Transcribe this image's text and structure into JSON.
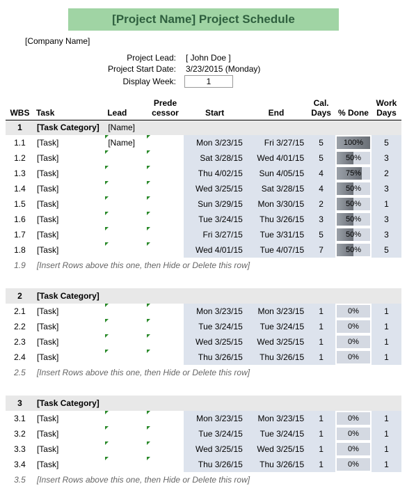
{
  "title": "[Project Name] Project Schedule",
  "company": "[Company Name]",
  "meta": {
    "lead_label": "Project Lead:",
    "lead_value": "[ John Doe ]",
    "start_label": "Project Start Date:",
    "start_value": "3/23/2015 (Monday)",
    "week_label": "Display Week:",
    "week_value": "1"
  },
  "headers": {
    "wbs": "WBS",
    "task": "Task",
    "lead": "Lead",
    "pred": "Prede cessor",
    "start": "Start",
    "end": "End",
    "cal": "Cal. Days",
    "pct": "% Done",
    "work": "Work Days"
  },
  "insert_text": "[Insert Rows above this one, then Hide or Delete this row]",
  "groups": [
    {
      "wbs": "1",
      "category": "[Task Category]",
      "lead": "[Name]",
      "rows": [
        {
          "wbs": "1.1",
          "task": "[Task]",
          "lead": "[Name]",
          "start": "Mon 3/23/15",
          "end": "Fri 3/27/15",
          "cal": "5",
          "pct": 100,
          "pct_txt": "100%",
          "work": "5"
        },
        {
          "wbs": "1.2",
          "task": "[Task]",
          "lead": "",
          "start": "Sat 3/28/15",
          "end": "Wed 4/01/15",
          "cal": "5",
          "pct": 50,
          "pct_txt": "50%",
          "work": "3"
        },
        {
          "wbs": "1.3",
          "task": "[Task]",
          "lead": "",
          "start": "Thu 4/02/15",
          "end": "Sun 4/05/15",
          "cal": "4",
          "pct": 75,
          "pct_txt": "75%",
          "work": "2"
        },
        {
          "wbs": "1.4",
          "task": "[Task]",
          "lead": "",
          "start": "Wed 3/25/15",
          "end": "Sat 3/28/15",
          "cal": "4",
          "pct": 50,
          "pct_txt": "50%",
          "work": "3"
        },
        {
          "wbs": "1.5",
          "task": "[Task]",
          "lead": "",
          "start": "Sun 3/29/15",
          "end": "Mon 3/30/15",
          "cal": "2",
          "pct": 50,
          "pct_txt": "50%",
          "work": "1"
        },
        {
          "wbs": "1.6",
          "task": "[Task]",
          "lead": "",
          "start": "Tue 3/24/15",
          "end": "Thu 3/26/15",
          "cal": "3",
          "pct": 50,
          "pct_txt": "50%",
          "work": "3"
        },
        {
          "wbs": "1.7",
          "task": "[Task]",
          "lead": "",
          "start": "Fri 3/27/15",
          "end": "Tue 3/31/15",
          "cal": "5",
          "pct": 50,
          "pct_txt": "50%",
          "work": "3"
        },
        {
          "wbs": "1.8",
          "task": "[Task]",
          "lead": "",
          "start": "Wed 4/01/15",
          "end": "Tue 4/07/15",
          "cal": "7",
          "pct": 50,
          "pct_txt": "50%",
          "work": "5"
        }
      ],
      "insert_wbs": "1.9"
    },
    {
      "wbs": "2",
      "category": "[Task Category]",
      "lead": "",
      "rows": [
        {
          "wbs": "2.1",
          "task": "[Task]",
          "lead": "",
          "start": "Mon 3/23/15",
          "end": "Mon 3/23/15",
          "cal": "1",
          "pct": 0,
          "pct_txt": "0%",
          "work": "1"
        },
        {
          "wbs": "2.2",
          "task": "[Task]",
          "lead": "",
          "start": "Tue 3/24/15",
          "end": "Tue 3/24/15",
          "cal": "1",
          "pct": 0,
          "pct_txt": "0%",
          "work": "1"
        },
        {
          "wbs": "2.3",
          "task": "[Task]",
          "lead": "",
          "start": "Wed 3/25/15",
          "end": "Wed 3/25/15",
          "cal": "1",
          "pct": 0,
          "pct_txt": "0%",
          "work": "1"
        },
        {
          "wbs": "2.4",
          "task": "[Task]",
          "lead": "",
          "start": "Thu 3/26/15",
          "end": "Thu 3/26/15",
          "cal": "1",
          "pct": 0,
          "pct_txt": "0%",
          "work": "1"
        }
      ],
      "insert_wbs": "2.5"
    },
    {
      "wbs": "3",
      "category": "[Task Category]",
      "lead": "",
      "rows": [
        {
          "wbs": "3.1",
          "task": "[Task]",
          "lead": "",
          "start": "Mon 3/23/15",
          "end": "Mon 3/23/15",
          "cal": "1",
          "pct": 0,
          "pct_txt": "0%",
          "work": "1"
        },
        {
          "wbs": "3.2",
          "task": "[Task]",
          "lead": "",
          "start": "Tue 3/24/15",
          "end": "Tue 3/24/15",
          "cal": "1",
          "pct": 0,
          "pct_txt": "0%",
          "work": "1"
        },
        {
          "wbs": "3.3",
          "task": "[Task]",
          "lead": "",
          "start": "Wed 3/25/15",
          "end": "Wed 3/25/15",
          "cal": "1",
          "pct": 0,
          "pct_txt": "0%",
          "work": "1"
        },
        {
          "wbs": "3.4",
          "task": "[Task]",
          "lead": "",
          "start": "Thu 3/26/15",
          "end": "Thu 3/26/15",
          "cal": "1",
          "pct": 0,
          "pct_txt": "0%",
          "work": "1"
        }
      ],
      "insert_wbs": "3.5"
    }
  ]
}
